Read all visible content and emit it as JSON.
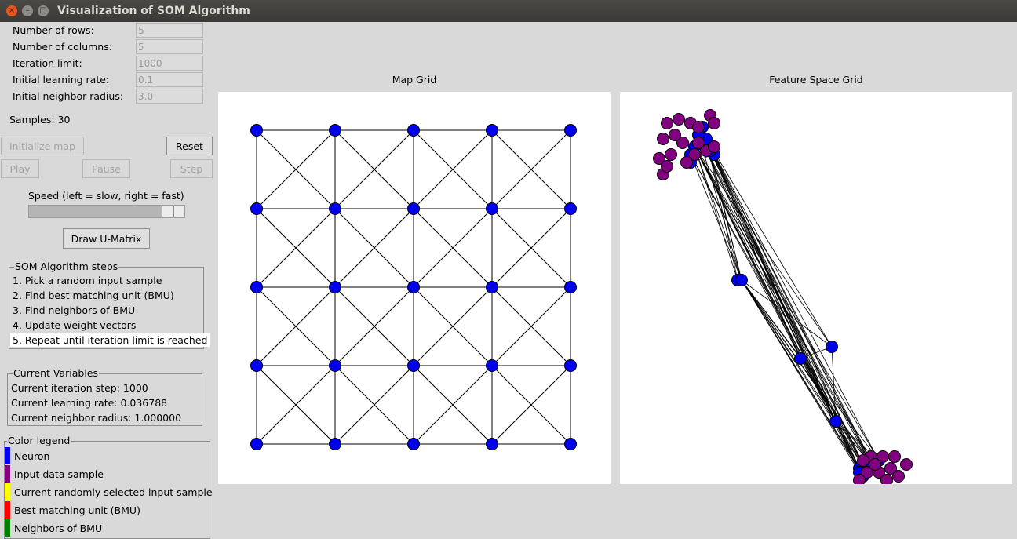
{
  "window": {
    "title": "Visualization of SOM Algorithm",
    "close_glyph": "×",
    "min_glyph": "–",
    "max_glyph": "□"
  },
  "params": [
    {
      "label": "Number of rows:",
      "value": "5"
    },
    {
      "label": "Number of columns:",
      "value": "5"
    },
    {
      "label": "Iteration limit:",
      "value": "1000"
    },
    {
      "label": "Initial learning rate:",
      "value": "0.1"
    },
    {
      "label": "Initial neighbor radius:",
      "value": "3.0"
    }
  ],
  "samples_text": "Samples: 30",
  "buttons": {
    "initialize": "Initialize map",
    "reset": "Reset",
    "play": "Play",
    "pause": "Pause",
    "step": "Step",
    "umatrix": "Draw U-Matrix"
  },
  "speed": {
    "label": "Speed (left = slow, right = fast)",
    "value_fraction": 0.9
  },
  "steps": {
    "title": "SOM Algorithm steps",
    "items": [
      "1. Pick a random input sample",
      "2. Find best matching unit (BMU)",
      "3. Find neighbors of BMU",
      "4. Update weight vectors",
      "5. Repeat until iteration limit is reached"
    ],
    "selected_index": 4
  },
  "current": {
    "title": "Current Variables",
    "items": [
      "Current iteration step: 1000",
      "Current learning rate: 0.036788",
      "Current neighbor radius: 1.000000"
    ]
  },
  "legend": {
    "title": "Color legend",
    "items": [
      {
        "label": "Neuron",
        "color": "#0000ee"
      },
      {
        "label": "Input data sample",
        "color": "#800080"
      },
      {
        "label": "Current randomly selected input sample",
        "color": "#ffff00"
      },
      {
        "label": "Best matching unit (BMU)",
        "color": "#ff0000"
      },
      {
        "label": "Neighbors of BMU",
        "color": "#008000"
      }
    ]
  },
  "map_grid": {
    "title": "Map Grid",
    "rows": 5,
    "cols": 5,
    "neuron_color": "#0000ee"
  },
  "feature_grid": {
    "title": "Feature Space Grid",
    "neuron_color": "#0000ee",
    "sample_color": "#800080",
    "neurons": [
      [
        0.19,
        0.14
      ],
      [
        0.18,
        0.18
      ],
      [
        0.21,
        0.09
      ],
      [
        0.22,
        0.12
      ],
      [
        0.24,
        0.16
      ],
      [
        0.3,
        0.48
      ],
      [
        0.31,
        0.48
      ],
      [
        0.54,
        0.65
      ],
      [
        0.46,
        0.68
      ],
      [
        0.55,
        0.84
      ],
      [
        0.61,
        0.96
      ],
      [
        0.64,
        0.95
      ],
      [
        0.63,
        0.97
      ],
      [
        0.66,
        0.94
      ],
      [
        0.62,
        0.98
      ],
      [
        0.2,
        0.11
      ],
      [
        0.23,
        0.15
      ],
      [
        0.18,
        0.16
      ],
      [
        0.65,
        0.96
      ],
      [
        0.61,
        0.97
      ]
    ],
    "samples": [
      [
        0.11,
        0.12
      ],
      [
        0.12,
        0.08
      ],
      [
        0.15,
        0.07
      ],
      [
        0.18,
        0.08
      ],
      [
        0.2,
        0.09
      ],
      [
        0.23,
        0.06
      ],
      [
        0.24,
        0.08
      ],
      [
        0.1,
        0.17
      ],
      [
        0.13,
        0.16
      ],
      [
        0.16,
        0.13
      ],
      [
        0.19,
        0.16
      ],
      [
        0.22,
        0.15
      ],
      [
        0.11,
        0.21
      ],
      [
        0.17,
        0.18
      ],
      [
        0.14,
        0.11
      ],
      [
        0.24,
        0.14
      ],
      [
        0.12,
        0.19
      ],
      [
        0.2,
        0.13
      ],
      [
        0.64,
        0.93
      ],
      [
        0.67,
        0.93
      ],
      [
        0.7,
        0.93
      ],
      [
        0.69,
        0.96
      ],
      [
        0.66,
        0.97
      ],
      [
        0.63,
        0.97
      ],
      [
        0.61,
        0.99
      ],
      [
        0.68,
        0.99
      ],
      [
        0.71,
        0.98
      ],
      [
        0.65,
        0.95
      ],
      [
        0.62,
        0.94
      ],
      [
        0.73,
        0.95
      ]
    ]
  }
}
